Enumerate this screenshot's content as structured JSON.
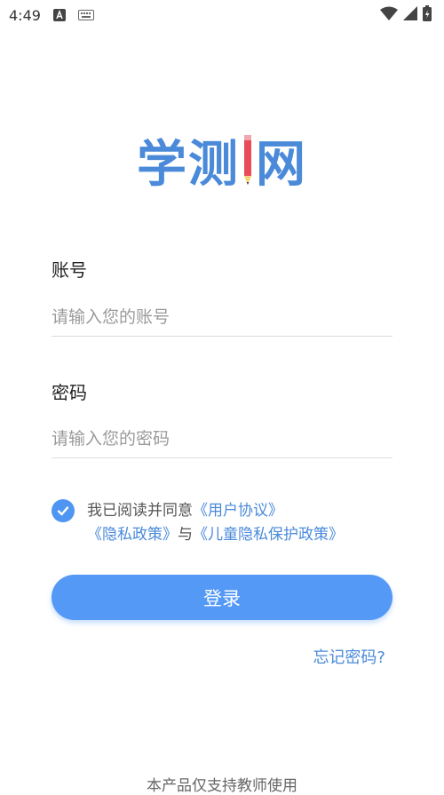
{
  "status_bar": {
    "time": "4:49",
    "icons": [
      "a-app-icon",
      "keyboard-icon",
      "wifi-icon",
      "signal-icon",
      "battery-icon"
    ]
  },
  "logo": {
    "text_left": "学测",
    "text_right": "网"
  },
  "account": {
    "label": "账号",
    "placeholder": "请输入您的账号",
    "value": ""
  },
  "password": {
    "label": "密码",
    "placeholder": "请输入您的密码",
    "value": ""
  },
  "agreement": {
    "checked": true,
    "prefix": "我已阅读并同意",
    "user_agreement": "《用户协议》",
    "privacy_policy": "《隐私政策》",
    "and": "与",
    "child_privacy_policy": "《儿童隐私保护政策》"
  },
  "login_button": "登录",
  "forgot_password": "忘记密码?",
  "footer": "本产品仅支持教师使用",
  "colors": {
    "accent": "#4a8ad9",
    "button": "#5499f6"
  }
}
